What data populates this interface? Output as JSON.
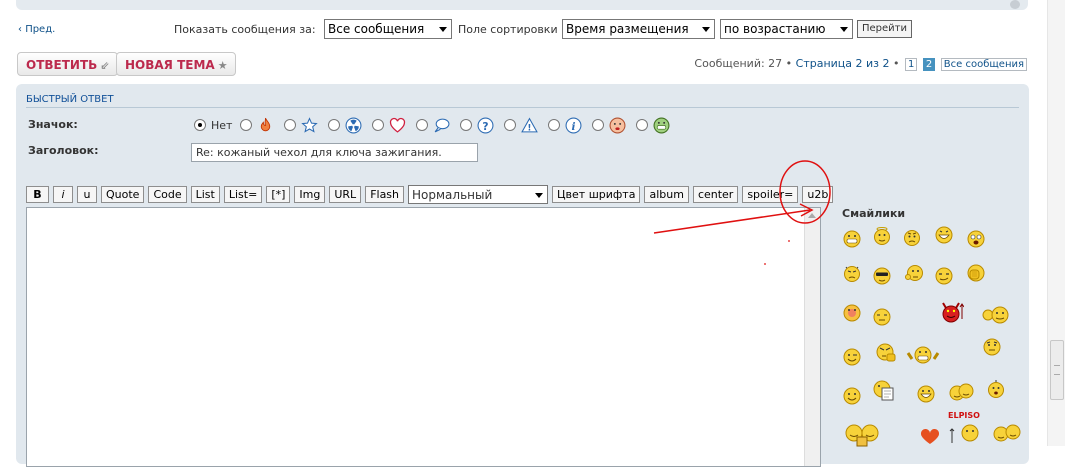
{
  "nav": {
    "prev_label": "Пред."
  },
  "filters": {
    "show_label": "Показать сообщения за:",
    "show_value": "Все сообщения",
    "sort_label": "Поле сортировки",
    "sort_value": "Время размещения",
    "order_value": "по возрастанию",
    "go_label": "Перейти"
  },
  "actions": {
    "reply_label": "ОТВЕТИТЬ",
    "new_topic_label": "НОВАЯ ТЕМА"
  },
  "pagination": {
    "count_text": "Сообщений: 27 •",
    "page_text": "Страница 2 из 2",
    "bullet": "•",
    "pages": [
      "1",
      "2"
    ],
    "all_posts": "Все сообщения"
  },
  "quick_reply": {
    "title": "БЫСТРЫЙ ОТВЕТ",
    "icon_label": "Значок:",
    "none_label": "Нет",
    "subject_label": "Заголовок:",
    "subject_value": "Re: кожаный чехол для ключа зажигания.",
    "toolbar": {
      "b": "B",
      "i": "i",
      "u": "u",
      "quote": "Quote",
      "code": "Code",
      "list": "List",
      "list_eq": "List=",
      "star": "[*]",
      "img": "Img",
      "url": "URL",
      "flash": "Flash",
      "size_value": "Нормальный",
      "font_color": "Цвет шрифта",
      "album": "album",
      "center": "center",
      "spoiler": "spoiler=",
      "u2b": "u2b"
    },
    "smileys_title": "Смайлики",
    "elpis_text": "ELPISO"
  },
  "colors": {
    "accent_red": "#bc2a4d",
    "link_blue": "#105289",
    "panel_bg": "#e1e8ee",
    "annotation": "#e01010"
  }
}
